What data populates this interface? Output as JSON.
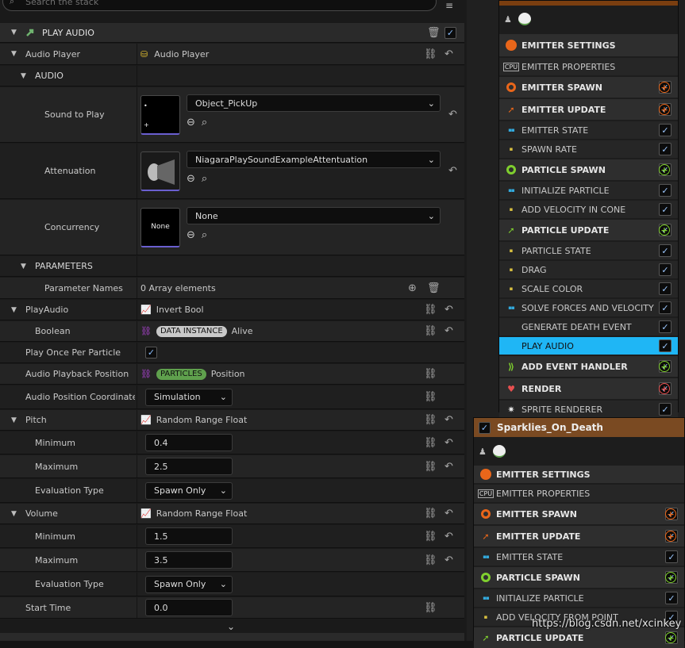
{
  "search": {
    "placeholder": "Search the stack"
  },
  "stack": {
    "section_title": "PLAY AUDIO",
    "rows": {
      "audio_player": {
        "label": "Audio Player",
        "value": "Audio Player"
      },
      "audio_cat": {
        "label": "AUDIO"
      },
      "sound": {
        "label": "Sound to Play",
        "value": "Object_PickUp"
      },
      "attenuation": {
        "label": "Attenuation",
        "value": "NiagaraPlaySoundExampleAttentuation"
      },
      "concurrency": {
        "label": "Concurrency",
        "value": "None",
        "thumb": "None"
      },
      "params_cat": {
        "label": "PARAMETERS"
      },
      "param_names": {
        "label": "Parameter Names",
        "value": "0 Array elements"
      },
      "playaudio": {
        "label": "PlayAudio",
        "value": "Invert Bool"
      },
      "boolean": {
        "label": "Boolean",
        "pill": "DATA INSTANCE",
        "value": "Alive"
      },
      "play_once": {
        "label": "Play Once Per Particle"
      },
      "playback_pos": {
        "label": "Audio Playback Position",
        "pill": "PARTICLES",
        "value": "Position"
      },
      "pos_space": {
        "label": "Audio Position Coordinate Sp",
        "value": "Simulation"
      },
      "pitch": {
        "label": "Pitch",
        "value": "Random Range Float"
      },
      "pitch_min": {
        "label": "Minimum",
        "value": "0.4"
      },
      "pitch_max": {
        "label": "Maximum",
        "value": "2.5"
      },
      "pitch_eval": {
        "label": "Evaluation Type",
        "value": "Spawn Only"
      },
      "volume": {
        "label": "Volume",
        "value": "Random Range Float"
      },
      "vol_min": {
        "label": "Minimum",
        "value": "1.5"
      },
      "vol_max": {
        "label": "Maximum",
        "value": "3.5"
      },
      "vol_eval": {
        "label": "Evaluation Type",
        "value": "Spawn Only"
      },
      "start_time": {
        "label": "Start Time",
        "value": "0.0"
      }
    }
  },
  "node1": {
    "items": [
      {
        "text": "EMITTER SETTINGS"
      },
      {
        "text": "EMITTER PROPERTIES"
      },
      {
        "text": "EMITTER SPAWN"
      },
      {
        "text": "EMITTER UPDATE"
      },
      {
        "text": "EMITTER STATE"
      },
      {
        "text": "SPAWN RATE"
      },
      {
        "text": "PARTICLE SPAWN"
      },
      {
        "text": "INITIALIZE PARTICLE"
      },
      {
        "text": "ADD VELOCITY IN CONE"
      },
      {
        "text": "PARTICLE UPDATE"
      },
      {
        "text": "PARTICLE STATE"
      },
      {
        "text": "DRAG"
      },
      {
        "text": "SCALE COLOR"
      },
      {
        "text": "SOLVE FORCES AND VELOCITY"
      },
      {
        "text": "GENERATE DEATH EVENT"
      },
      {
        "text": "PLAY AUDIO"
      },
      {
        "text": "ADD EVENT HANDLER"
      },
      {
        "text": "RENDER"
      },
      {
        "text": "SPRITE RENDERER"
      }
    ]
  },
  "node2": {
    "title": "Sparklies_On_Death",
    "items": [
      {
        "text": "EMITTER SETTINGS"
      },
      {
        "text": "EMITTER PROPERTIES"
      },
      {
        "text": "EMITTER SPAWN"
      },
      {
        "text": "EMITTER UPDATE"
      },
      {
        "text": "EMITTER STATE"
      },
      {
        "text": "PARTICLE SPAWN"
      },
      {
        "text": "INITIALIZE PARTICLE"
      },
      {
        "text": "ADD VELOCITY FROM POINT"
      },
      {
        "text": "PARTICLE UPDATE"
      }
    ]
  },
  "cpu_badge": "CPU",
  "watermark": "https://blog.csdn.net/xcinkey",
  "colors": {
    "selected": "#1fb6f5",
    "orange": "#e9661a",
    "green": "#7fcf2e",
    "red": "#e85050",
    "pill_data": "#c9c9c9",
    "pill_particles": "#5fa04d"
  }
}
